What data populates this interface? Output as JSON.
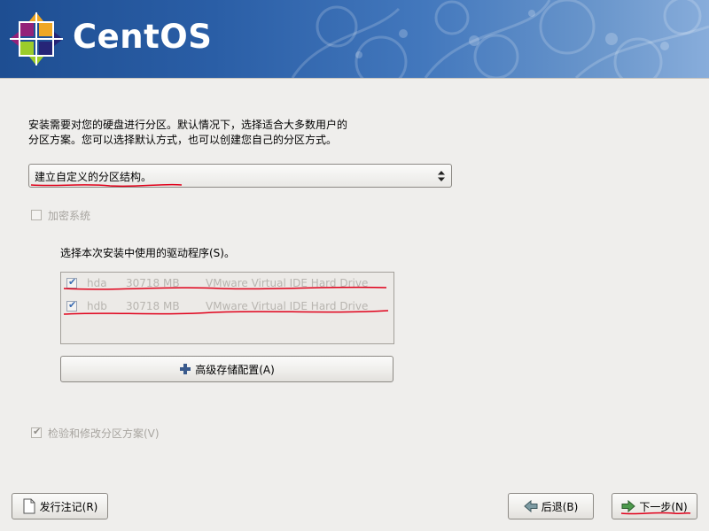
{
  "banner": {
    "brand": "CentOS"
  },
  "intro": {
    "line1": "安装需要对您的硬盘进行分区。默认情况下，选择适合大多数用户的",
    "line2": "分区方案。您可以选择默认方式，也可以创建您自己的分区方式。"
  },
  "partition_combo": {
    "value": "建立自定义的分区结构。"
  },
  "encrypt": {
    "label": "加密系统",
    "checked": false
  },
  "drives": {
    "heading": "选择本次安装中使用的驱动程序(S)。",
    "items": [
      {
        "device": "hda",
        "size": "30718 MB",
        "model": "VMware Virtual IDE Hard Drive",
        "checked": true
      },
      {
        "device": "hdb",
        "size": "30718 MB",
        "model": "VMware Virtual IDE Hard Drive",
        "checked": true
      }
    ]
  },
  "advanced_button": {
    "label": "高级存储配置(A)"
  },
  "review": {
    "label": "检验和修改分区方案(V)",
    "checked": true
  },
  "footer": {
    "release_notes_label": "发行注记(R)",
    "back_label": "后退(B)",
    "next_label": "下一步(N)"
  },
  "colors": {
    "banner": "#2a5ea6",
    "annotation": "#e0001a",
    "background": "#efeeec"
  }
}
